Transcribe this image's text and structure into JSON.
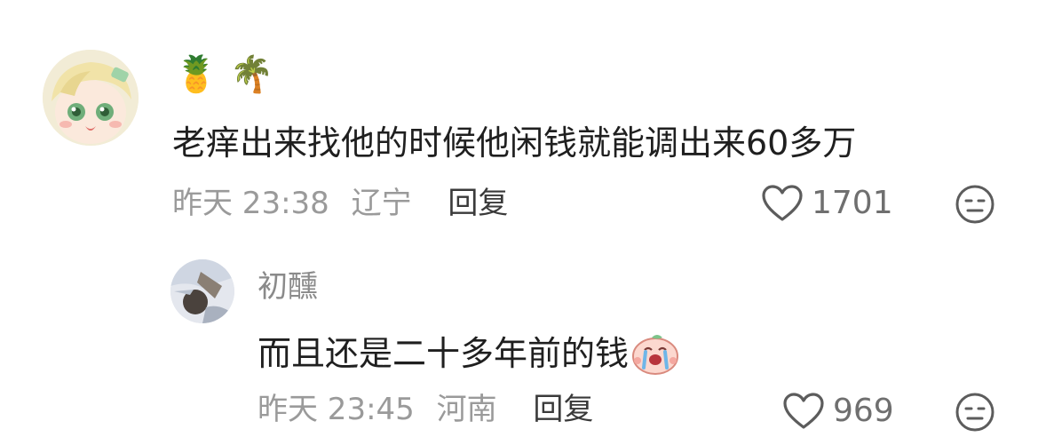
{
  "comments": [
    {
      "username": "🍍 🌴",
      "text": "老痒出来找他的时候他闲钱就能调出来60多万",
      "time": "昨天 23:38",
      "location": "辽宁",
      "reply_label": "回复",
      "likes": "1701",
      "avatar_icon": "plush-doll-avatar",
      "dislike_icon": "expressionless-face-icon"
    },
    {
      "username": "初醺",
      "text": "而且还是二十多年前的钱",
      "text_emoji": "crying-peach-sticker",
      "time": "昨天 23:45",
      "location": "河南",
      "reply_label": "回复",
      "likes": "969",
      "avatar_icon": "sketch-drawing-avatar",
      "dislike_icon": "expressionless-face-icon"
    }
  ]
}
